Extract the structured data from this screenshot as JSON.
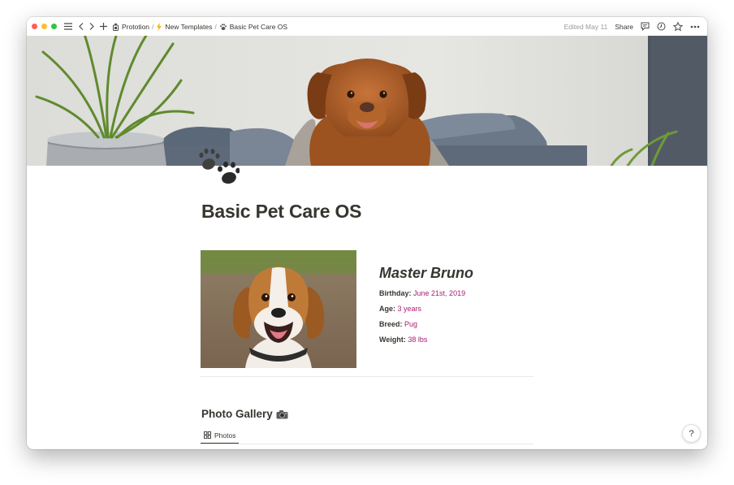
{
  "breadcrumb": [
    {
      "label": "Prototion"
    },
    {
      "label": "New Templates"
    },
    {
      "label": "Basic Pet Care OS"
    }
  ],
  "topbar": {
    "edited": "Edited May 11",
    "share_label": "Share"
  },
  "page": {
    "title": "Basic Pet Care OS",
    "icon": "paw-print-icon"
  },
  "pet": {
    "name": "Master Bruno",
    "details": [
      {
        "key": "Birthday:",
        "value": "June 21st, 2019"
      },
      {
        "key": "Age:",
        "value": "3 years"
      },
      {
        "key": "Breed:",
        "value": "Pug"
      },
      {
        "key": "Weight:",
        "value": "38 lbs"
      }
    ]
  },
  "gallery": {
    "title": "Photo Gallery",
    "tab_label": "Photos"
  },
  "help_label": "?",
  "colors": {
    "property_value": "#ad1a72",
    "text": "#37352f"
  }
}
